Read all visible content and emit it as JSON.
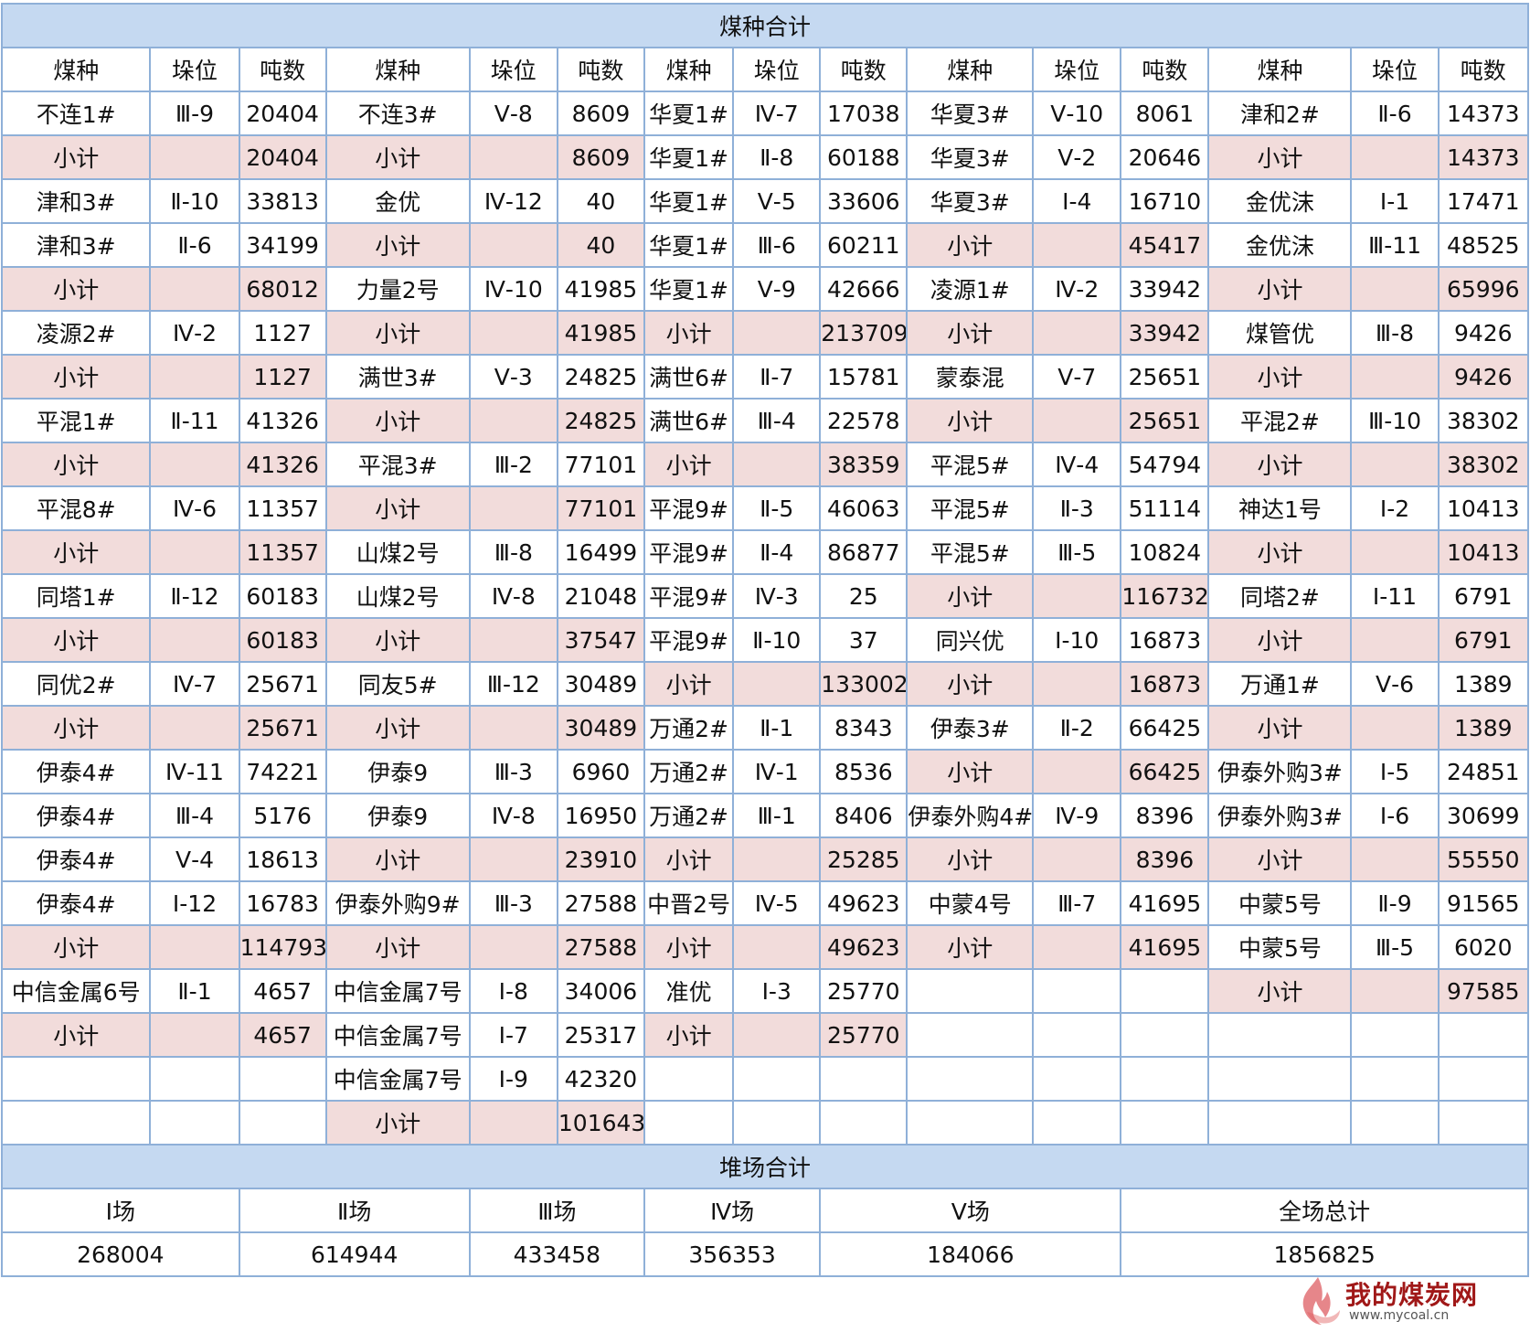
{
  "title": "煤种合计",
  "column_headers": [
    "煤种",
    "垛位",
    "吨数",
    "煤种",
    "垛位",
    "吨数",
    "煤种",
    "垛位",
    "吨数",
    "煤种",
    "垛位",
    "吨数",
    "煤种",
    "垛位",
    "吨数"
  ],
  "rows": [
    [
      [
        "不连1#",
        "Ⅲ-9",
        "20404"
      ],
      [
        "不连3#",
        "Ⅴ-8",
        "8609"
      ],
      [
        "华夏1#",
        "Ⅳ-7",
        "17038"
      ],
      [
        "华夏3#",
        "Ⅴ-10",
        "8061"
      ],
      [
        "津和2#",
        "Ⅱ-6",
        "14373"
      ]
    ],
    [
      [
        "小计",
        "",
        "20404"
      ],
      [
        "小计",
        "",
        "8609"
      ],
      [
        "华夏1#",
        "Ⅱ-8",
        "60188"
      ],
      [
        "华夏3#",
        "Ⅴ-2",
        "20646"
      ],
      [
        "小计",
        "",
        "14373"
      ]
    ],
    [
      [
        "津和3#",
        "Ⅱ-10",
        "33813"
      ],
      [
        "金优",
        "Ⅳ-12",
        "40"
      ],
      [
        "华夏1#",
        "Ⅴ-5",
        "33606"
      ],
      [
        "华夏3#",
        "Ⅰ-4",
        "16710"
      ],
      [
        "金优沫",
        "Ⅰ-1",
        "17471"
      ]
    ],
    [
      [
        "津和3#",
        "Ⅱ-6",
        "34199"
      ],
      [
        "小计",
        "",
        "40"
      ],
      [
        "华夏1#",
        "Ⅲ-6",
        "60211"
      ],
      [
        "小计",
        "",
        "45417"
      ],
      [
        "金优沫",
        "Ⅲ-11",
        "48525"
      ]
    ],
    [
      [
        "小计",
        "",
        "68012"
      ],
      [
        "力量2号",
        "Ⅳ-10",
        "41985"
      ],
      [
        "华夏1#",
        "Ⅴ-9",
        "42666"
      ],
      [
        "凌源1#",
        "Ⅳ-2",
        "33942"
      ],
      [
        "小计",
        "",
        "65996"
      ]
    ],
    [
      [
        "凌源2#",
        "Ⅳ-2",
        "1127"
      ],
      [
        "小计",
        "",
        "41985"
      ],
      [
        "小计",
        "",
        "213709"
      ],
      [
        "小计",
        "",
        "33942"
      ],
      [
        "煤管优",
        "Ⅲ-8",
        "9426"
      ]
    ],
    [
      [
        "小计",
        "",
        "1127"
      ],
      [
        "满世3#",
        "Ⅴ-3",
        "24825"
      ],
      [
        "满世6#",
        "Ⅱ-7",
        "15781"
      ],
      [
        "蒙泰混",
        "Ⅴ-7",
        "25651"
      ],
      [
        "小计",
        "",
        "9426"
      ]
    ],
    [
      [
        "平混1#",
        "Ⅱ-11",
        "41326"
      ],
      [
        "小计",
        "",
        "24825"
      ],
      [
        "满世6#",
        "Ⅲ-4",
        "22578"
      ],
      [
        "小计",
        "",
        "25651"
      ],
      [
        "平混2#",
        "Ⅲ-10",
        "38302"
      ]
    ],
    [
      [
        "小计",
        "",
        "41326"
      ],
      [
        "平混3#",
        "Ⅲ-2",
        "77101"
      ],
      [
        "小计",
        "",
        "38359"
      ],
      [
        "平混5#",
        "Ⅳ-4",
        "54794"
      ],
      [
        "小计",
        "",
        "38302"
      ]
    ],
    [
      [
        "平混8#",
        "Ⅳ-6",
        "11357"
      ],
      [
        "小计",
        "",
        "77101"
      ],
      [
        "平混9#",
        "Ⅱ-5",
        "46063"
      ],
      [
        "平混5#",
        "Ⅱ-3",
        "51114"
      ],
      [
        "神达1号",
        "Ⅰ-2",
        "10413"
      ]
    ],
    [
      [
        "小计",
        "",
        "11357"
      ],
      [
        "山煤2号",
        "Ⅲ-8",
        "16499"
      ],
      [
        "平混9#",
        "Ⅱ-4",
        "86877"
      ],
      [
        "平混5#",
        "Ⅲ-5",
        "10824"
      ],
      [
        "小计",
        "",
        "10413"
      ]
    ],
    [
      [
        "同塔1#",
        "Ⅱ-12",
        "60183"
      ],
      [
        "山煤2号",
        "Ⅳ-8",
        "21048"
      ],
      [
        "平混9#",
        "Ⅳ-3",
        "25"
      ],
      [
        "小计",
        "",
        "116732"
      ],
      [
        "同塔2#",
        "Ⅰ-11",
        "6791"
      ]
    ],
    [
      [
        "小计",
        "",
        "60183"
      ],
      [
        "小计",
        "",
        "37547"
      ],
      [
        "平混9#",
        "Ⅱ-10",
        "37"
      ],
      [
        "同兴优",
        "Ⅰ-10",
        "16873"
      ],
      [
        "小计",
        "",
        "6791"
      ]
    ],
    [
      [
        "同优2#",
        "Ⅳ-7",
        "25671"
      ],
      [
        "同友5#",
        "Ⅲ-12",
        "30489"
      ],
      [
        "小计",
        "",
        "133002"
      ],
      [
        "小计",
        "",
        "16873"
      ],
      [
        "万通1#",
        "Ⅴ-6",
        "1389"
      ]
    ],
    [
      [
        "小计",
        "",
        "25671"
      ],
      [
        "小计",
        "",
        "30489"
      ],
      [
        "万通2#",
        "Ⅱ-1",
        "8343"
      ],
      [
        "伊泰3#",
        "Ⅱ-2",
        "66425"
      ],
      [
        "小计",
        "",
        "1389"
      ]
    ],
    [
      [
        "伊泰4#",
        "Ⅳ-11",
        "74221"
      ],
      [
        "伊泰9",
        "Ⅲ-3",
        "6960"
      ],
      [
        "万通2#",
        "Ⅳ-1",
        "8536"
      ],
      [
        "小计",
        "",
        "66425"
      ],
      [
        "伊泰外购3#",
        "Ⅰ-5",
        "24851"
      ]
    ],
    [
      [
        "伊泰4#",
        "Ⅲ-4",
        "5176"
      ],
      [
        "伊泰9",
        "Ⅳ-8",
        "16950"
      ],
      [
        "万通2#",
        "Ⅲ-1",
        "8406"
      ],
      [
        "伊泰外购4#",
        "Ⅳ-9",
        "8396"
      ],
      [
        "伊泰外购3#",
        "Ⅰ-6",
        "30699"
      ]
    ],
    [
      [
        "伊泰4#",
        "Ⅴ-4",
        "18613"
      ],
      [
        "小计",
        "",
        "23910"
      ],
      [
        "小计",
        "",
        "25285"
      ],
      [
        "小计",
        "",
        "8396"
      ],
      [
        "小计",
        "",
        "55550"
      ]
    ],
    [
      [
        "伊泰4#",
        "Ⅰ-12",
        "16783"
      ],
      [
        "伊泰外购9#",
        "Ⅲ-3",
        "27588"
      ],
      [
        "中晋2号",
        "Ⅳ-5",
        "49623"
      ],
      [
        "中蒙4号",
        "Ⅲ-7",
        "41695"
      ],
      [
        "中蒙5号",
        "Ⅱ-9",
        "91565"
      ]
    ],
    [
      [
        "小计",
        "",
        "114793"
      ],
      [
        "小计",
        "",
        "27588"
      ],
      [
        "小计",
        "",
        "49623"
      ],
      [
        "小计",
        "",
        "41695"
      ],
      [
        "中蒙5号",
        "Ⅲ-5",
        "6020"
      ]
    ],
    [
      [
        "中信金属6号",
        "Ⅱ-1",
        "4657"
      ],
      [
        "中信金属7号",
        "Ⅰ-8",
        "34006"
      ],
      [
        "准优",
        "Ⅰ-3",
        "25770"
      ],
      [
        "",
        "",
        ""
      ],
      [
        "小计",
        "",
        "97585"
      ]
    ],
    [
      [
        "小计",
        "",
        "4657"
      ],
      [
        "中信金属7号",
        "Ⅰ-7",
        "25317"
      ],
      [
        "小计",
        "",
        "25770"
      ],
      [
        "",
        "",
        ""
      ],
      [
        "",
        "",
        ""
      ]
    ],
    [
      [
        "",
        "",
        ""
      ],
      [
        "中信金属7号",
        "Ⅰ-9",
        "42320"
      ],
      [
        "",
        "",
        ""
      ],
      [
        "",
        "",
        ""
      ],
      [
        "",
        "",
        ""
      ]
    ],
    [
      [
        "",
        "",
        ""
      ],
      [
        "小计",
        "",
        "101643"
      ],
      [
        "",
        "",
        ""
      ],
      [
        "",
        "",
        ""
      ],
      [
        "",
        "",
        ""
      ]
    ]
  ],
  "summary": {
    "title": "堆场合计",
    "headers": [
      "Ⅰ场",
      "Ⅱ场",
      "Ⅲ场",
      "Ⅳ场",
      "Ⅴ场",
      "全场总计"
    ],
    "values": [
      "268004",
      "614944",
      "433458",
      "356353",
      "184066",
      "1856825"
    ]
  },
  "watermark": {
    "text": "我的煤炭网",
    "url": "www.mycoal.cn"
  },
  "colors": {
    "header_bg": "#c5d9f1",
    "subtotal_bg": "#f2dcdb",
    "border": "#8fb0d8"
  }
}
